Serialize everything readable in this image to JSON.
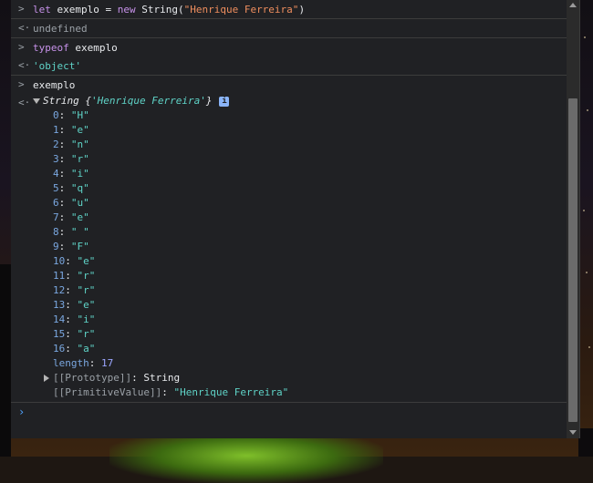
{
  "console": {
    "entries": [
      {
        "prefix": "let ",
        "ident": "exemplo = ",
        "kw_new": "new",
        "call": " String(",
        "arg": "\"Henrique Ferreira\"",
        "close": ")"
      },
      {
        "result": "undefined"
      },
      {
        "kw_typeof": "typeof",
        "rest": " exemplo"
      },
      {
        "result": "'object'"
      },
      {
        "ident": "exemplo"
      }
    ],
    "object": {
      "type_label": "String ",
      "open_brace": "{",
      "preview": "'Henrique Ferreira'",
      "close_brace": "}",
      "info_badge": "i",
      "chars": [
        {
          "k": "0",
          "v": "\"H\""
        },
        {
          "k": "1",
          "v": "\"e\""
        },
        {
          "k": "2",
          "v": "\"n\""
        },
        {
          "k": "3",
          "v": "\"r\""
        },
        {
          "k": "4",
          "v": "\"i\""
        },
        {
          "k": "5",
          "v": "\"q\""
        },
        {
          "k": "6",
          "v": "\"u\""
        },
        {
          "k": "7",
          "v": "\"e\""
        },
        {
          "k": "8",
          "v": "\" \""
        },
        {
          "k": "9",
          "v": "\"F\""
        },
        {
          "k": "10",
          "v": "\"e\""
        },
        {
          "k": "11",
          "v": "\"r\""
        },
        {
          "k": "12",
          "v": "\"r\""
        },
        {
          "k": "13",
          "v": "\"e\""
        },
        {
          "k": "14",
          "v": "\"i\""
        },
        {
          "k": "15",
          "v": "\"r\""
        },
        {
          "k": "16",
          "v": "\"a\""
        }
      ],
      "length_key": "length",
      "length_value": "17",
      "prototype_key": "[[Prototype]]",
      "prototype_value": "String",
      "primitive_key": "[[PrimitiveValue]]",
      "primitive_value": "\"Henrique Ferreira\""
    },
    "glyphs": {
      "input": ">",
      "output": "<·",
      "prompt": "›"
    }
  }
}
